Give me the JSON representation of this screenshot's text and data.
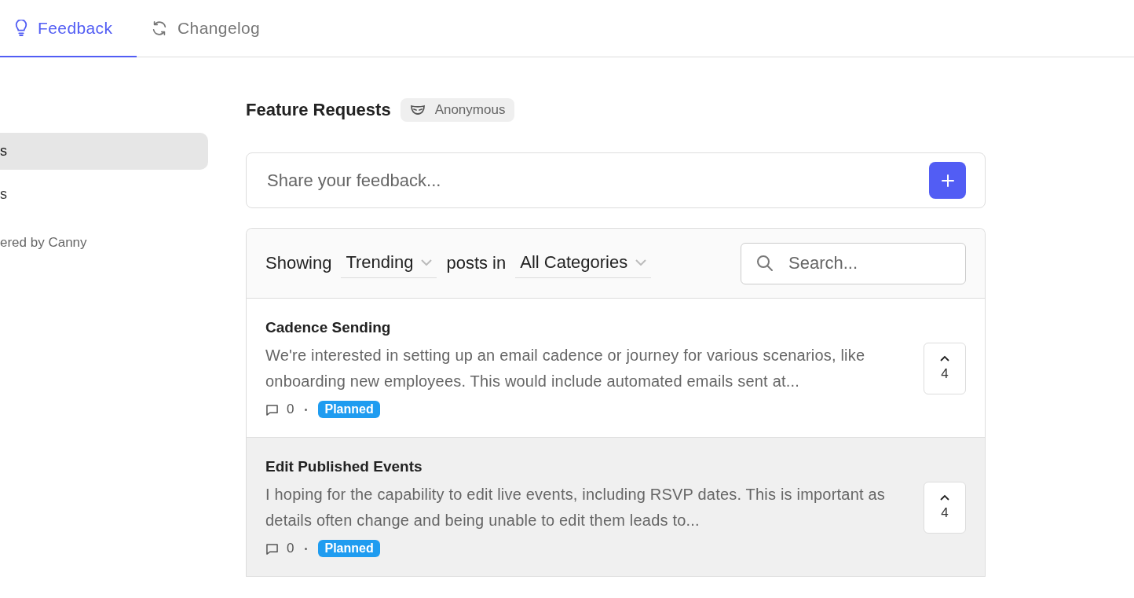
{
  "tabs": [
    {
      "label": "Feedback",
      "selected": true
    },
    {
      "label": "Changelog",
      "selected": false
    }
  ],
  "sidebar": {
    "items": [
      {
        "label": "s",
        "selected": true
      },
      {
        "label": "s",
        "selected": false
      }
    ],
    "footer": "ered by Canny"
  },
  "board": {
    "title": "Feature Requests",
    "badge": "Anonymous"
  },
  "composer": {
    "placeholder": "Share your feedback..."
  },
  "filter": {
    "prefix": "Showing",
    "sort": "Trending",
    "middle": "posts in",
    "category": "All Categories",
    "search_placeholder": "Search..."
  },
  "posts": [
    {
      "title": "Cadence Sending",
      "body": "We're interested in setting up an email cadence or journey for various scenarios, like onboarding new employees. This would include automated emails sent at...",
      "comments": "0",
      "status": "Planned",
      "color": "#1f9cf0",
      "votes": "4",
      "highlighted": false
    },
    {
      "title": "Edit Published Events",
      "body": "I hoping for the capability to edit live events, including RSVP dates. This is important as details often change and being unable to edit them leads to...",
      "comments": "0",
      "status": "Planned",
      "color": "#1f9cf0",
      "votes": "4",
      "highlighted": true
    }
  ]
}
